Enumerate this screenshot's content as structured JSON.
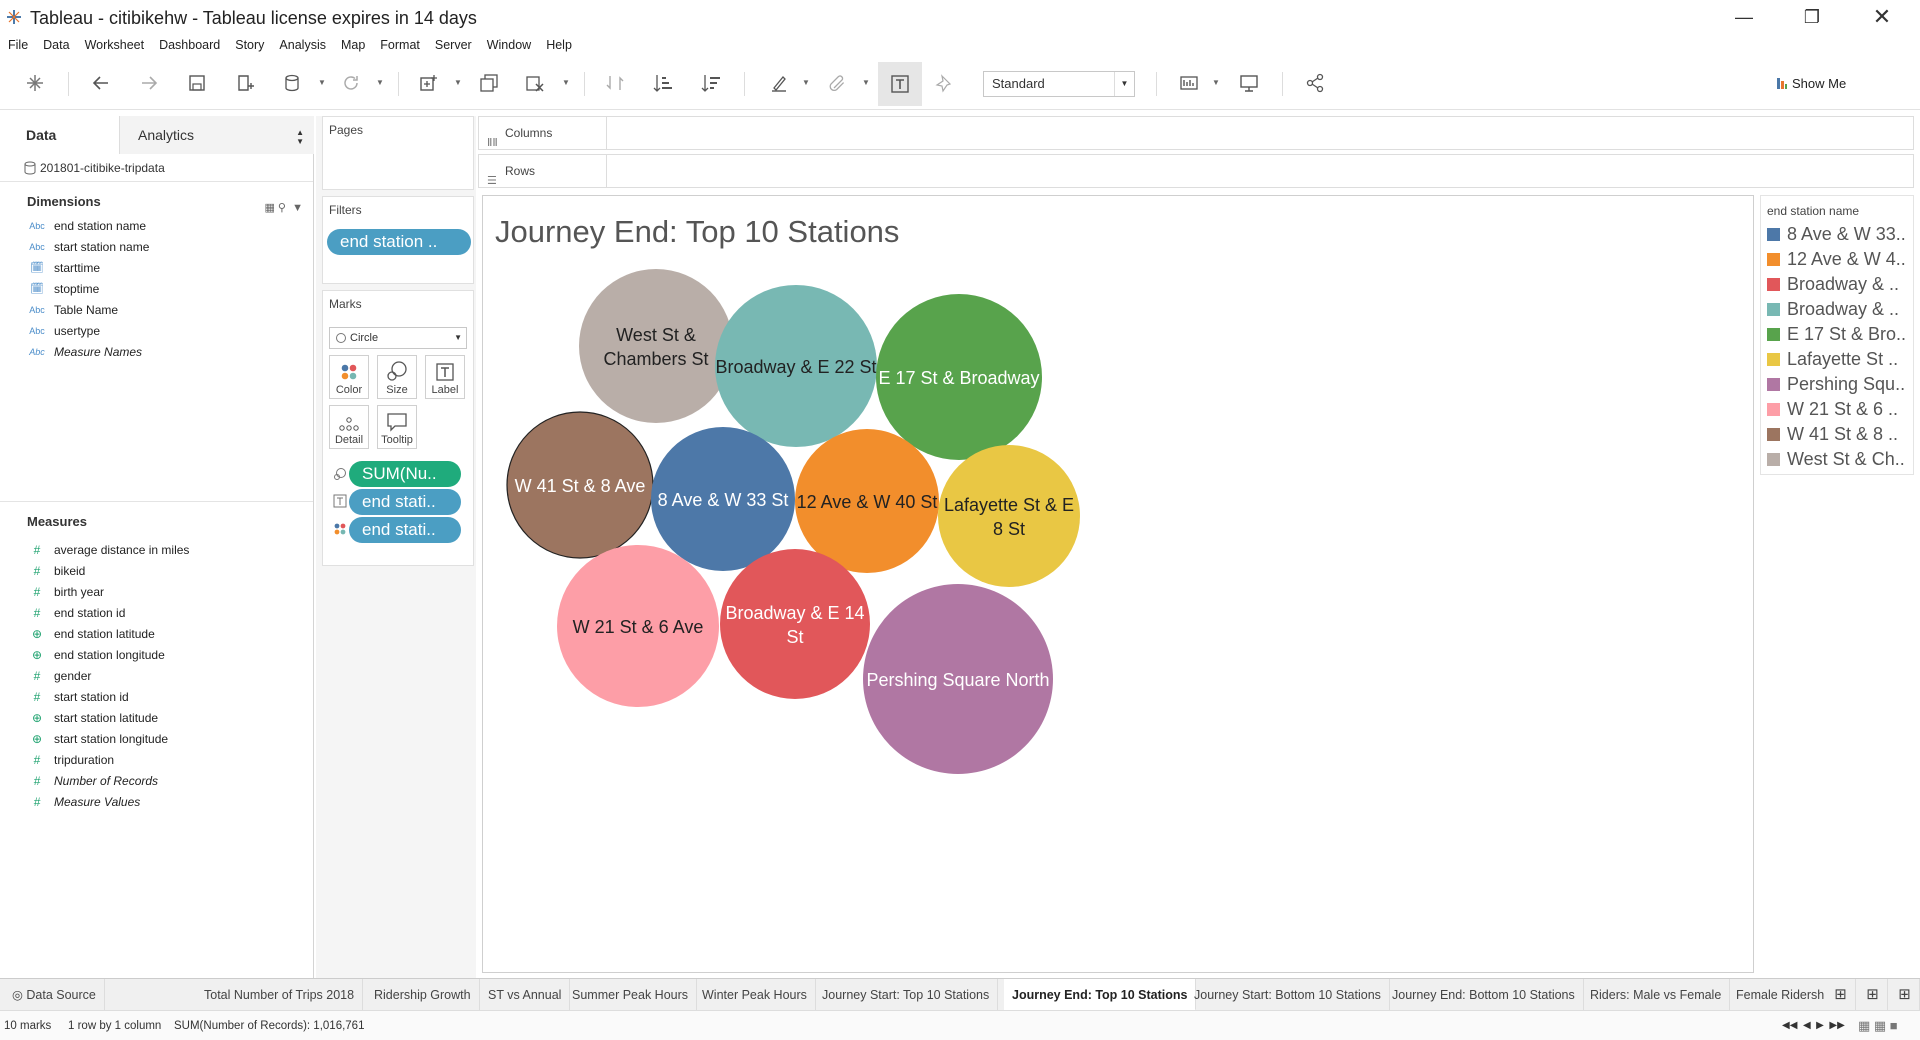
{
  "window": {
    "title": "Tableau - citibikehw - Tableau license expires in 14 days"
  },
  "menu": [
    "File",
    "Data",
    "Worksheet",
    "Dashboard",
    "Story",
    "Analysis",
    "Map",
    "Format",
    "Server",
    "Window",
    "Help"
  ],
  "toolbar": {
    "fit_select": "Standard",
    "show_me": "Show Me"
  },
  "left_panel": {
    "tab_data": "Data",
    "tab_analytics": "Analytics",
    "datasource": "201801-citibike-tripdata",
    "dimensions_header": "Dimensions",
    "dimensions": [
      {
        "icon": "Abc",
        "label": "end station name"
      },
      {
        "icon": "Abc",
        "label": "start station name"
      },
      {
        "icon": "calendar-icon",
        "label": "starttime"
      },
      {
        "icon": "calendar-icon",
        "label": "stoptime"
      },
      {
        "icon": "Abc",
        "label": "Table Name"
      },
      {
        "icon": "Abc",
        "label": "usertype"
      },
      {
        "icon": "Abc",
        "label": "Measure Names"
      }
    ],
    "measures_header": "Measures",
    "measures": [
      {
        "icon": "#",
        "label": "average distance in miles"
      },
      {
        "icon": "#",
        "label": "bikeid"
      },
      {
        "icon": "#",
        "label": "birth year"
      },
      {
        "icon": "#",
        "label": "end station id"
      },
      {
        "icon": "globe-icon",
        "label": "end station latitude"
      },
      {
        "icon": "globe-icon",
        "label": "end station longitude"
      },
      {
        "icon": "#",
        "label": "gender"
      },
      {
        "icon": "#",
        "label": "start station id"
      },
      {
        "icon": "globe-icon",
        "label": "start station latitude"
      },
      {
        "icon": "globe-icon",
        "label": "start station longitude"
      },
      {
        "icon": "#",
        "label": "tripduration"
      },
      {
        "icon": "#",
        "label": "Number of Records"
      },
      {
        "icon": "#",
        "label": "Measure Values"
      }
    ]
  },
  "shelves": {
    "pages": "Pages",
    "filters": "Filters",
    "filter_pill": "end station ..",
    "marks": "Marks",
    "mark_type": "Circle",
    "mark_buttons": [
      "Color",
      "Size",
      "Label",
      "Detail",
      "Tooltip"
    ],
    "mark_pills": [
      "SUM(Nu..",
      "end stati..",
      "end stati.."
    ],
    "columns": "Columns",
    "rows": "Rows"
  },
  "viz": {
    "title": "Journey End: Top 10 Stations"
  },
  "chart_data": {
    "type": "packed-bubble",
    "title": "Journey End: Top 10 Stations",
    "bubbles": [
      {
        "label_lines": [
          "West St &",
          "Chambers St"
        ],
        "color": "#b9aea8",
        "text_color": "#222222"
      },
      {
        "label_lines": [
          "Broadway & E 22 St"
        ],
        "color": "#78b8b3",
        "text_color": "#222222"
      },
      {
        "label_lines": [
          "E 17 St & Broadway"
        ],
        "color": "#58a34c",
        "text_color": "#ffffff"
      },
      {
        "label_lines": [
          "W 41 St & 8 Ave"
        ],
        "color": "#9c7560",
        "text_color": "#ffffff"
      },
      {
        "label_lines": [
          "8 Ave & W 33 St"
        ],
        "color": "#4d78a8",
        "text_color": "#ffffff"
      },
      {
        "label_lines": [
          "12 Ave & W 40 St"
        ],
        "color": "#f28e2c",
        "text_color": "#222222"
      },
      {
        "label_lines": [
          "Lafayette St & E",
          "8 St"
        ],
        "color": "#e9c744",
        "text_color": "#222222"
      },
      {
        "label_lines": [
          "W 21 St & 6 Ave"
        ],
        "color": "#fd9ea7",
        "text_color": "#222222"
      },
      {
        "label_lines": [
          "Broadway & E 14",
          "St"
        ],
        "color": "#e1575a",
        "text_color": "#ffffff"
      },
      {
        "label_lines": [
          "Pershing Square North"
        ],
        "color": "#b077a3",
        "text_color": "#ffffff"
      }
    ]
  },
  "legend": {
    "title": "end station name",
    "items": [
      {
        "label": "8 Ave & W 33..",
        "color": "#4d78a8"
      },
      {
        "label": "12 Ave & W 4..",
        "color": "#f28e2c"
      },
      {
        "label": "Broadway & ..",
        "color": "#e1575a"
      },
      {
        "label": "Broadway & ..",
        "color": "#78b8b3"
      },
      {
        "label": "E 17 St & Bro..",
        "color": "#58a34c"
      },
      {
        "label": "Lafayette St ..",
        "color": "#e9c744"
      },
      {
        "label": "Pershing Squ..",
        "color": "#b077a3"
      },
      {
        "label": "W 21 St & 6 ..",
        "color": "#fd9ea7"
      },
      {
        "label": "W 41 St & 8 ..",
        "color": "#9c7560"
      },
      {
        "label": "West St & Ch..",
        "color": "#b9aea8"
      }
    ]
  },
  "sheet_tabs": [
    "Data Source",
    "Total Number of Trips 2018",
    "Ridership Growth",
    "ST vs Annual",
    "Summer Peak Hours",
    "Winter Peak Hours",
    "Journey Start: Top 10 Stations",
    "Journey End: Top 10 Stations",
    "Journey Start: Bottom 10 Stations",
    "Journey End: Bottom 10 Stations",
    "Riders: Male vs Female",
    "Female Ridershi"
  ],
  "active_tab": "Journey End: Top 10 Stations",
  "status": {
    "marks": "10 marks",
    "rows_cols": "1 row by 1 column",
    "sum": "SUM(Number of Records): 1,016,761"
  }
}
